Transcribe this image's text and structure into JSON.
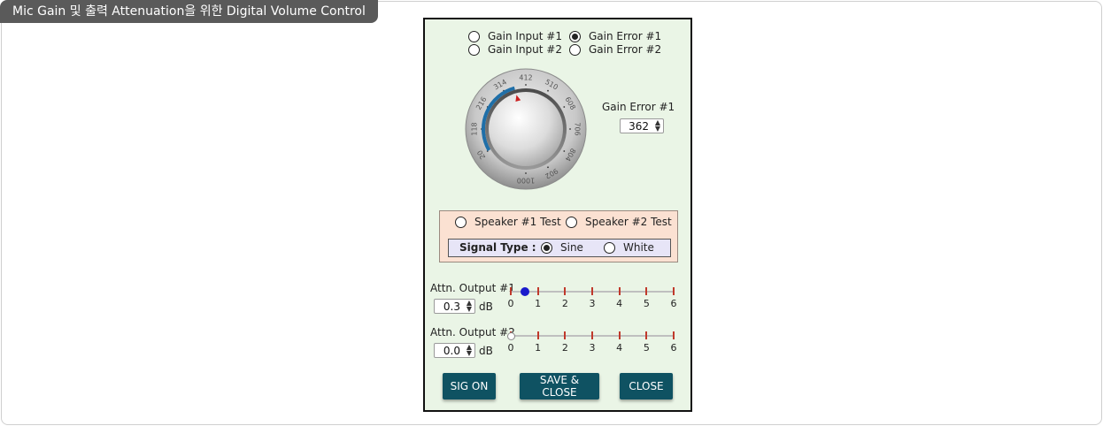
{
  "title": "Mic Gain 및 출력 Attenuation을 위한 Digital Volume Control",
  "mode_radios": [
    {
      "label": "Gain Input #1",
      "checked": false
    },
    {
      "label": "Gain Error #1",
      "checked": true
    },
    {
      "label": "Gain Input #2",
      "checked": false
    },
    {
      "label": "Gain Error #2",
      "checked": false
    }
  ],
  "knob": {
    "scale_labels": [
      "20",
      "118",
      "216",
      "314",
      "412",
      "510",
      "608",
      "706",
      "804",
      "902",
      "1000"
    ],
    "value": 362
  },
  "gain": {
    "label": "Gain Error #1",
    "value": "362"
  },
  "speaker": {
    "test1": {
      "label": "Speaker #1 Test",
      "checked": false
    },
    "test2": {
      "label": "Speaker #2 Test",
      "checked": false
    },
    "signal_type_label": "Signal Type :",
    "sine": {
      "label": "Sine",
      "checked": true
    },
    "white": {
      "label": "White",
      "checked": false
    }
  },
  "attn1": {
    "label": "Attn. Output #1",
    "value": "0.3",
    "unit": "dB",
    "slider_value": 0.3,
    "ticks": [
      "0",
      "1",
      "2",
      "3",
      "4",
      "5",
      "6"
    ]
  },
  "attn2": {
    "label": "Attn. Output #2",
    "value": "0.0",
    "unit": "dB",
    "slider_value": 0.0,
    "ticks": [
      "0",
      "1",
      "2",
      "3",
      "4",
      "5",
      "6"
    ]
  },
  "buttons": {
    "sig_on": "SIG ON",
    "save_close": "SAVE & CLOSE",
    "close": "CLOSE"
  },
  "colors": {
    "panel_bg": "#eaf5e6",
    "button_bg": "#0f5262",
    "speaker_bg": "#fbe1d2",
    "signal_bg": "#e7e5f7",
    "tick": "#c0392b",
    "thumb": "#1a1acc"
  }
}
